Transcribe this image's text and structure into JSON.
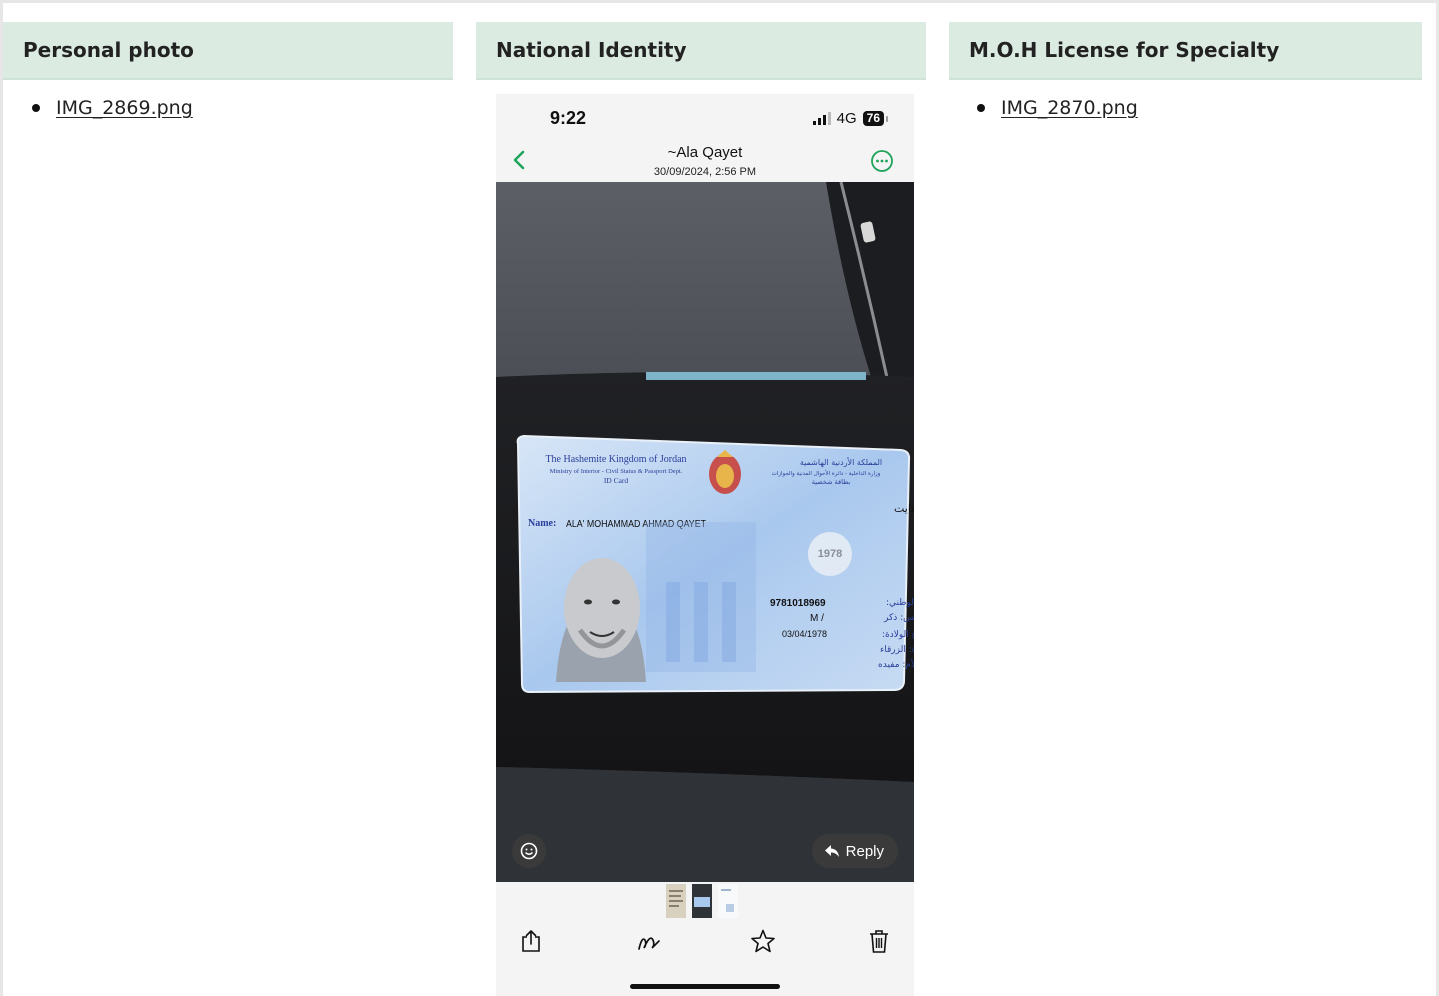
{
  "sections": {
    "personal_photo": {
      "title": "Personal photo",
      "files": [
        "IMG_2869.png"
      ]
    },
    "national_identity": {
      "title": "National Identity"
    },
    "moh_license": {
      "title": "M.O.H License for Specialty",
      "files": [
        "IMG_2870.png"
      ]
    }
  },
  "phone": {
    "status": {
      "time": "9:22",
      "network": "4G",
      "battery": "76"
    },
    "nav": {
      "contact": "~Ala Qayet",
      "timestamp": "30/09/2024, 2:56 PM"
    },
    "reply_label": "Reply",
    "id_card": {
      "header_en_1": "The Hashemite Kingdom of Jordan",
      "header_en_2": "Ministry of Interior - Civil Status & Passport Dept.",
      "header_en_3": "ID Card",
      "header_ar_1": "المملكة الأردنية الهاشمية",
      "header_ar_2": "وزارة الداخلية - دائرة الأحوال المدنية والجوازات",
      "header_ar_3": "بطاقة شخصية",
      "name_label": "Name:",
      "name_value": "ALA' MOHAMMAD AHMAD QAYET",
      "name_ar": "الاسم: علاء محمد احمد قايت",
      "year": "1978",
      "national_no": "9781018969",
      "national_no_ar": "الرقم الوطني:",
      "sex": "M /",
      "sex_ar": "الجنس: ذكر",
      "dob": "03/04/1978",
      "dob_ar": "تاريخ الولادة:",
      "pob_ar": "مكان الولادة: الزرقاء",
      "mother_ar": "اسم الأم: مفيده"
    },
    "colors": {
      "accent": "#1ea35a",
      "header_bg": "#dcebe2"
    }
  }
}
